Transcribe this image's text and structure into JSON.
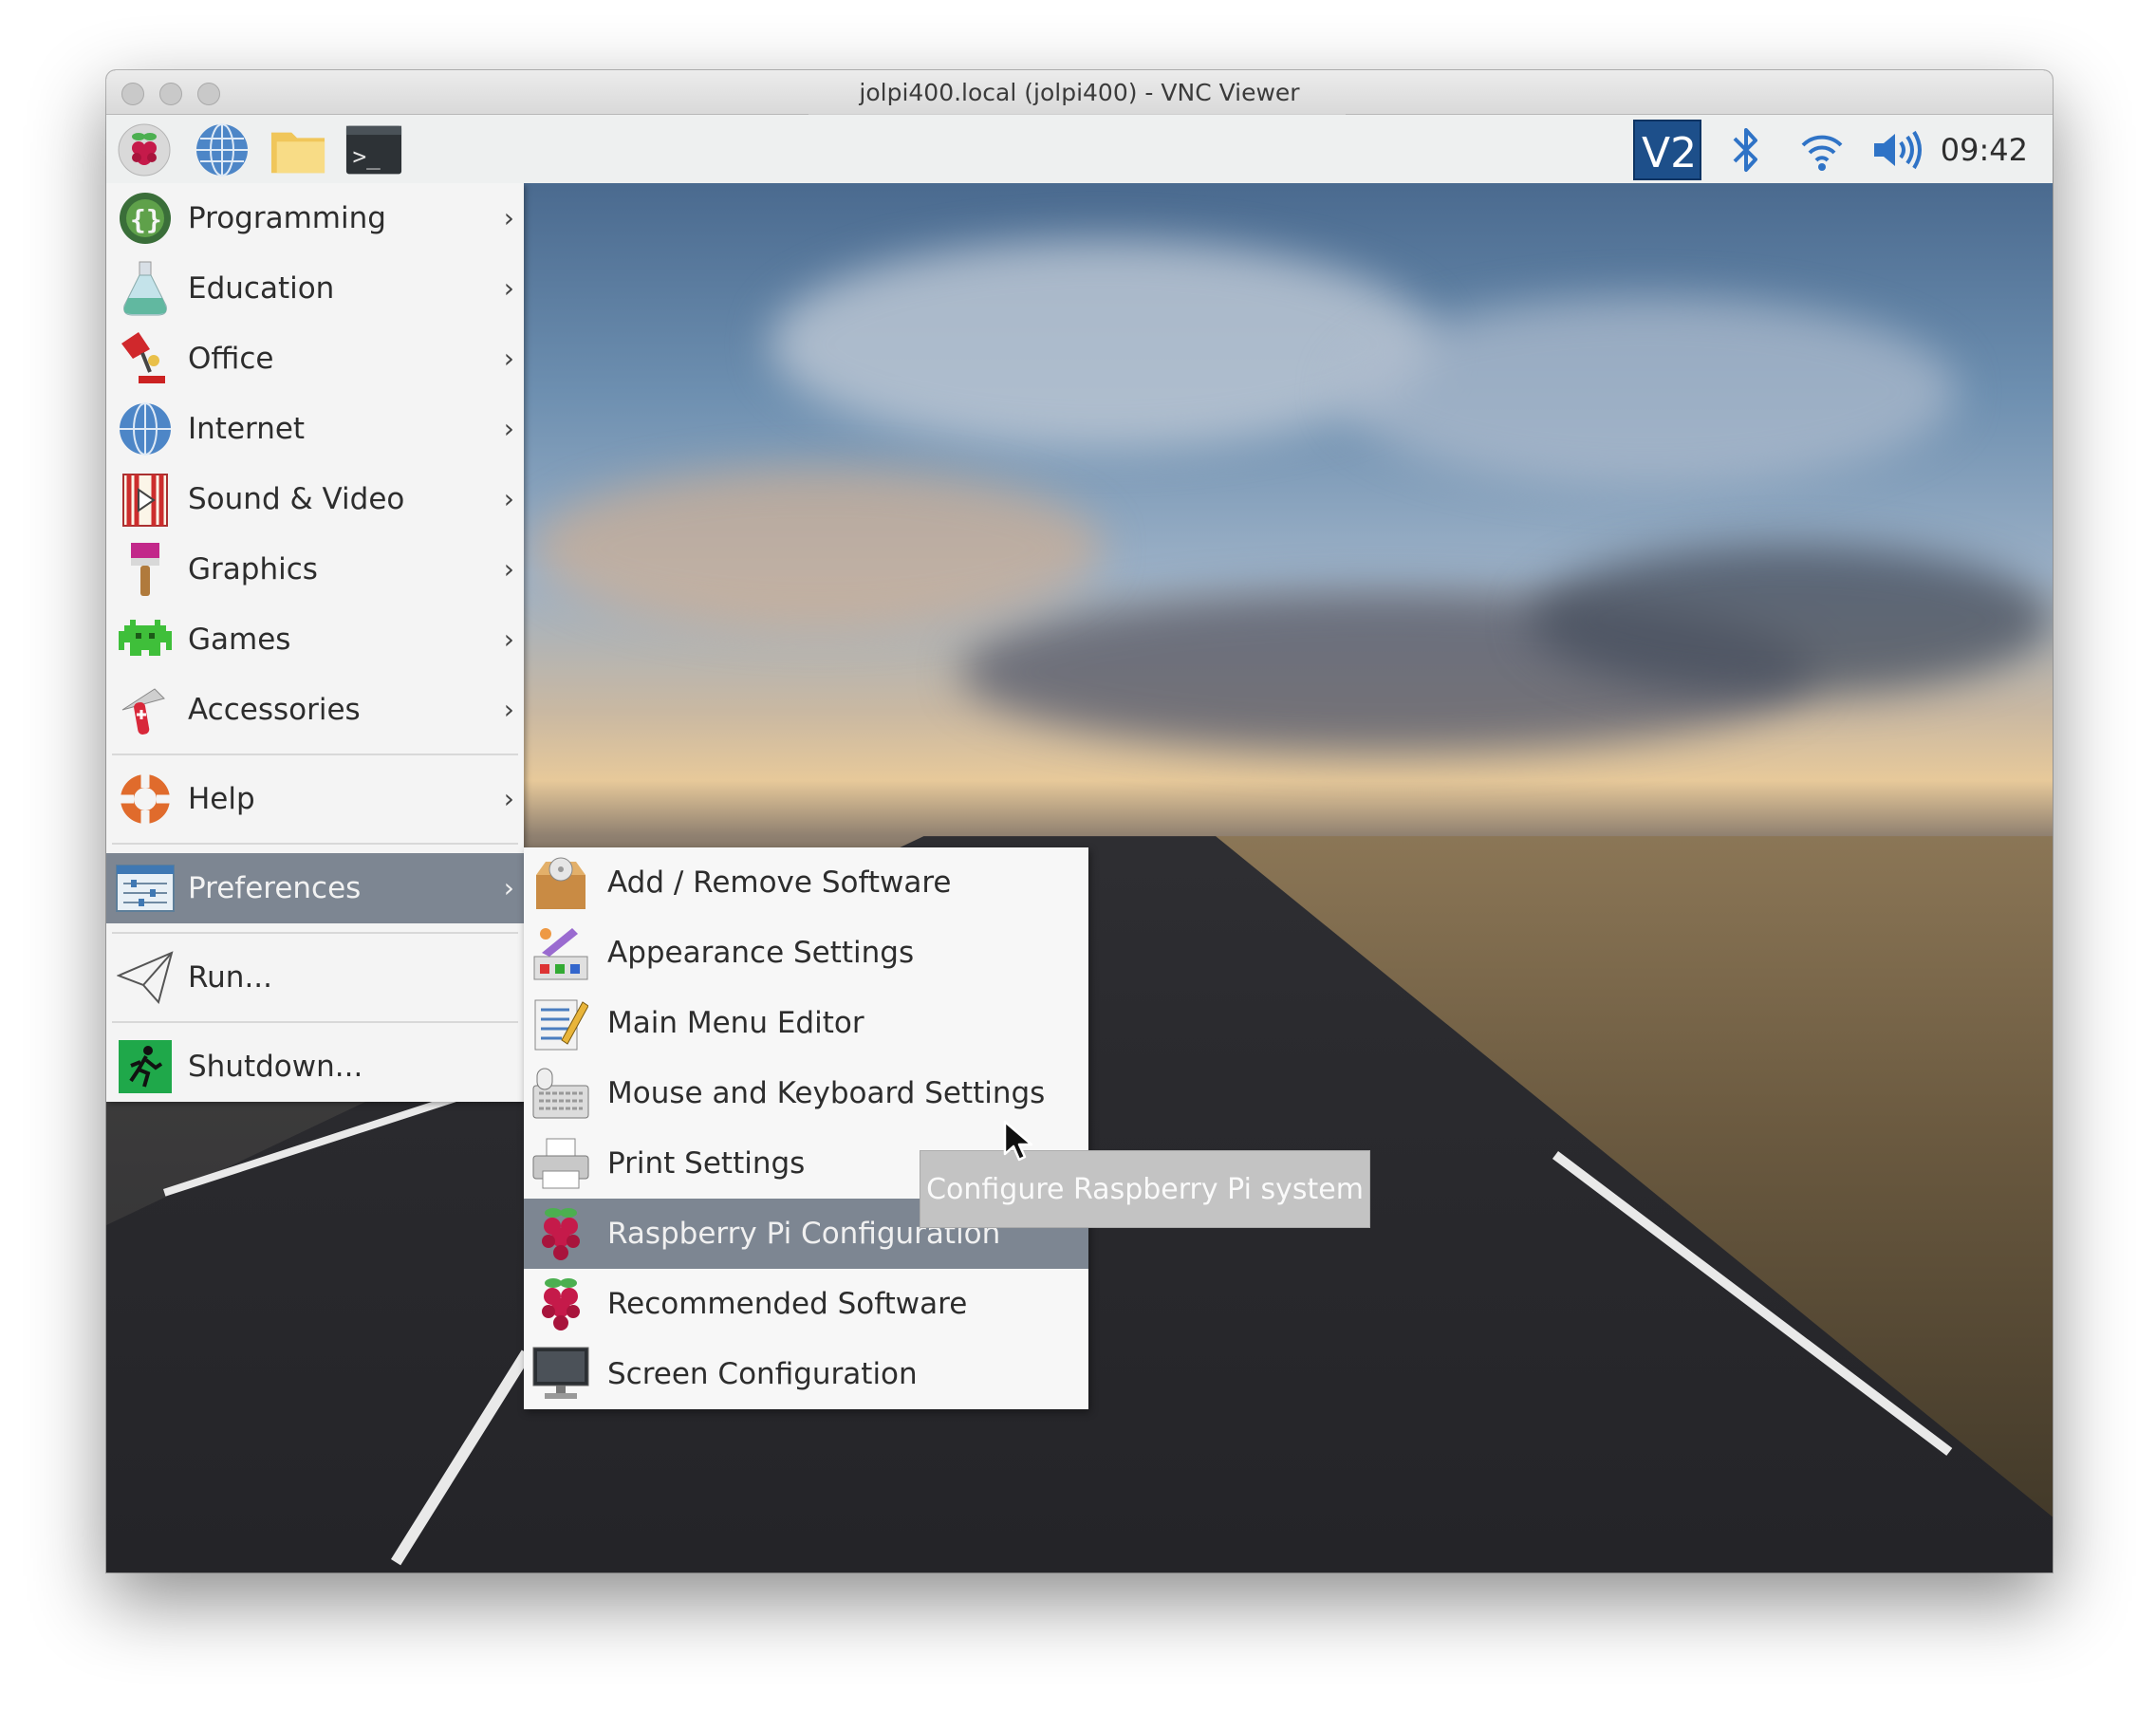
{
  "window": {
    "title": "jolpi400.local (jolpi400) - VNC Viewer"
  },
  "taskbar": {
    "icons": [
      "raspberry-menu-icon",
      "web-browser-icon",
      "file-manager-icon",
      "terminal-icon"
    ],
    "tray": [
      "vnc-icon",
      "bluetooth-icon",
      "wifi-icon",
      "volume-icon"
    ],
    "clock": "09:42"
  },
  "menu": {
    "items": [
      {
        "label": "Programming",
        "icon": "programming-icon"
      },
      {
        "label": "Education",
        "icon": "education-icon"
      },
      {
        "label": "Office",
        "icon": "office-icon"
      },
      {
        "label": "Internet",
        "icon": "internet-icon"
      },
      {
        "label": "Sound & Video",
        "icon": "sound-video-icon"
      },
      {
        "label": "Graphics",
        "icon": "graphics-icon"
      },
      {
        "label": "Games",
        "icon": "games-icon"
      },
      {
        "label": "Accessories",
        "icon": "accessories-icon"
      },
      {
        "label": "Help",
        "icon": "help-icon"
      },
      {
        "label": "Preferences",
        "icon": "preferences-icon",
        "selected": true
      },
      {
        "label": "Run...",
        "icon": "run-icon"
      },
      {
        "label": "Shutdown...",
        "icon": "shutdown-icon"
      }
    ],
    "arrow": "›"
  },
  "submenu": {
    "items": [
      {
        "label": "Add / Remove Software",
        "icon": "package-icon"
      },
      {
        "label": "Appearance Settings",
        "icon": "appearance-icon"
      },
      {
        "label": "Main Menu Editor",
        "icon": "menu-editor-icon"
      },
      {
        "label": "Mouse and Keyboard Settings",
        "icon": "keyboard-icon"
      },
      {
        "label": "Print Settings",
        "icon": "printer-icon"
      },
      {
        "label": "Raspberry Pi Configuration",
        "icon": "raspberry-icon",
        "selected": true
      },
      {
        "label": "Recommended Software",
        "icon": "raspberry-icon"
      },
      {
        "label": "Screen Configuration",
        "icon": "monitor-icon"
      }
    ]
  },
  "tooltip": {
    "text": "Configure Raspberry Pi system"
  },
  "colors": {
    "selection": "#7d8692",
    "menu_bg": "#f4f4f4",
    "vnc": "#1d4f8a"
  }
}
